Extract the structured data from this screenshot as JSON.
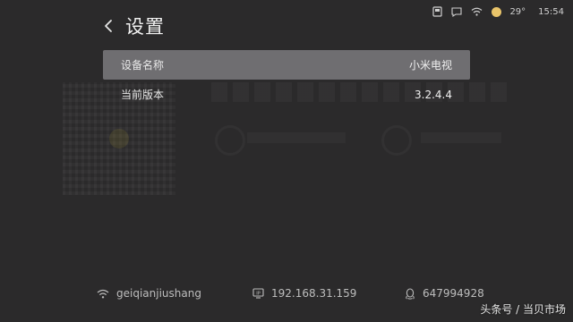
{
  "status_bar": {
    "temperature": "29°",
    "time": "15:54",
    "icons": [
      "storage-icon",
      "chat-icon",
      "wifi-icon",
      "weather-sun-icon"
    ]
  },
  "header": {
    "back_icon": "chevron-left-icon",
    "title": "设置"
  },
  "settings": [
    {
      "label": "设备名称",
      "value": "小米电视",
      "selected": true
    },
    {
      "label": "当前版本",
      "value": "3.2.4.4",
      "selected": false
    }
  ],
  "footer": {
    "wifi_name": "geiqianjiushang",
    "ip_address": "192.168.31.159",
    "qq_number": "647994928"
  },
  "watermark": "头条号 / 当贝市场",
  "colors": {
    "background": "#2b2a2b",
    "selected_row": "#6f6e71",
    "sun": "#e9c46a"
  }
}
